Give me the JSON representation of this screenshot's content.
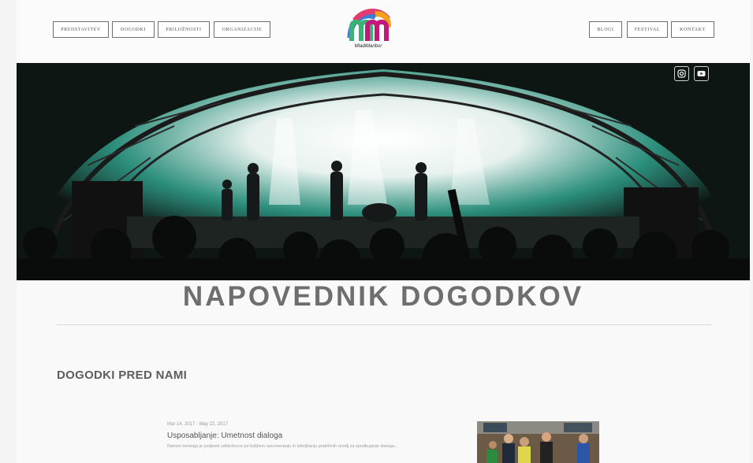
{
  "nav": {
    "left": [
      "PREDSTAVITEV",
      "DOGODKI",
      "PRILOŽNOSTI",
      "ORGANIZACIJE"
    ],
    "right": [
      "BLOGI",
      "FESTIVAL",
      "KONTAKT"
    ]
  },
  "logo": {
    "text": "MladiMaribor",
    "colors": [
      "#e33b6f",
      "#f2a31b",
      "#3a7bd5",
      "#3bb273"
    ]
  },
  "social": [
    "instagram-icon",
    "youtube-icon"
  ],
  "page_title": "NAPOVEDNIK DOGODKOV",
  "section_heading": "DOGODKI PRED NAMI",
  "events": [
    {
      "date": "Mar 14, 2017 - May 22, 2017",
      "title": "Usposabljanje: Umetnost dialoga",
      "description": "Namen treninga je podpreti udeležence pri boljšem razumevanju in izboljšanju praktičnih orodij za spodbujanje dialoga..."
    }
  ],
  "colors": {
    "title": "#6e6e6e",
    "heading": "#5d5d5d",
    "stage_green": "#2f9c87"
  }
}
